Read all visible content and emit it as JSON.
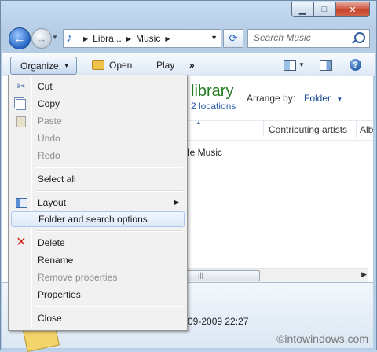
{
  "window": {
    "caption_buttons": [
      "minimize-icon",
      "maximize-icon",
      "close-icon"
    ]
  },
  "address_bar": {
    "segments": [
      "Libra...",
      "Music"
    ]
  },
  "search": {
    "placeholder": "Search Music"
  },
  "toolbar": {
    "organize_label": "Organize",
    "open_label": "Open",
    "play_label": "Play",
    "more_label": "»"
  },
  "content": {
    "library_title": "library",
    "library_sub": "2 locations",
    "arrange_label": "Arrange by:",
    "arrange_value": "Folder",
    "columns": [
      "Contributing artists",
      "Alb"
    ],
    "row_text": "le Music"
  },
  "details": {
    "date": "-09-2009 22:27"
  },
  "watermark": "©intowindows.com",
  "menu": {
    "items": [
      {
        "label": "Cut",
        "icon": "scissors-icon",
        "enabled": true
      },
      {
        "label": "Copy",
        "icon": "copy-icon",
        "enabled": true
      },
      {
        "label": "Paste",
        "icon": "paste-icon",
        "enabled": false
      },
      {
        "label": "Undo",
        "enabled": false
      },
      {
        "label": "Redo",
        "enabled": false
      },
      {
        "label": "Select all",
        "enabled": true
      },
      {
        "label": "Layout",
        "icon": "layout-icon",
        "enabled": true,
        "submenu": true
      },
      {
        "label": "Folder and search options",
        "enabled": true,
        "highlighted": true
      },
      {
        "label": "Delete",
        "icon": "delete-icon",
        "enabled": true
      },
      {
        "label": "Rename",
        "enabled": true
      },
      {
        "label": "Remove properties",
        "enabled": false
      },
      {
        "label": "Properties",
        "enabled": true
      },
      {
        "label": "Close",
        "enabled": true
      }
    ]
  }
}
